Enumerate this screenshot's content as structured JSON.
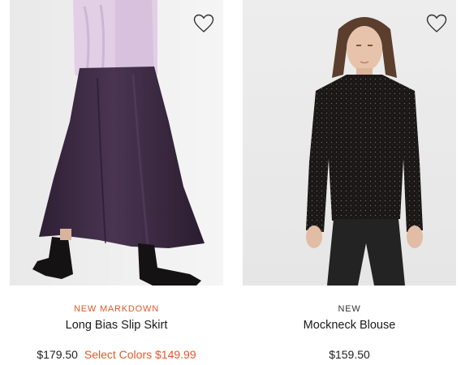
{
  "products": [
    {
      "badge": "NEW MARKDOWN",
      "name": "Long Bias Slip Skirt",
      "price_original": "$179.50",
      "price_sale": "Select Colors $149.99",
      "image_alt": "Long Bias Slip Skirt",
      "wishlist_icon": "heart-outline-icon"
    },
    {
      "badge": "NEW",
      "name": "Mockneck Blouse",
      "price": "$159.50",
      "image_alt": "Mockneck Blouse",
      "wishlist_icon": "heart-outline-icon"
    }
  ],
  "colors": {
    "markdown_accent": "#e0592a",
    "text": "#222222",
    "skirt": "#3d2a44",
    "sweater": "#e2cfe6",
    "blouse": "#1a1716"
  }
}
